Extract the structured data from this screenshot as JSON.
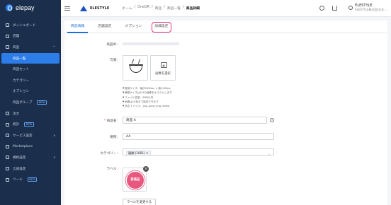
{
  "app": {
    "logo_text": "elepay"
  },
  "sidebar": {
    "items": [
      {
        "label": "ダッシュボード",
        "icon": "dashboard-icon"
      },
      {
        "label": "店舗",
        "icon": "store-icon"
      },
      {
        "label": "商品",
        "icon": "product-icon",
        "caret": "^"
      },
      {
        "label": "商品一覧",
        "sub": true,
        "active": true
      },
      {
        "label": "商品セット",
        "sub": true
      },
      {
        "label": "カテゴリー",
        "sub": true
      },
      {
        "label": "オプション",
        "sub": true
      },
      {
        "label": "商品グループ",
        "sub": true,
        "badge": "BETA"
      },
      {
        "label": "注文",
        "icon": "order-icon"
      },
      {
        "label": "統計",
        "icon": "stats-icon",
        "badge": "BETA"
      },
      {
        "label": "サービス設定",
        "icon": "service-icon",
        "caret": "v"
      },
      {
        "label": "Marketplace",
        "icon": "marketplace-icon"
      },
      {
        "label": "規約設定",
        "icon": "terms-icon",
        "caret": "v"
      },
      {
        "label": "言語設定",
        "icon": "language-icon"
      },
      {
        "label": "ツール",
        "icon": "tool-icon",
        "badge": "BETA"
      }
    ]
  },
  "topbar": {
    "brand": "ELESTYLE",
    "breadcrumbs": [
      "ホーム",
      "/",
      "OneQR",
      "/",
      "商品",
      "/",
      "商品一覧",
      "/"
    ],
    "current": "商品詳細",
    "user_name": "ELESTYLE",
    "user_company": "ELESTYLE株式会社(本..."
  },
  "tabs": [
    {
      "label": "商品情報",
      "active": true
    },
    {
      "label": "店舗設定"
    },
    {
      "label": "オプション"
    },
    {
      "label": "詳細設定",
      "highlight": true
    }
  ],
  "form": {
    "id_label": "商品ID:",
    "photo_label": "写真:",
    "photo_select_text": "画像を選択",
    "hints": [
      "推奨サイズ：幅が1600px × 高1200px",
      "横縦サイズは4:3の画像をオススメします",
      "ファイル容量：5MB以内",
      "画像は10枚まで追加できます",
      "対応ファイル：.jpg,.jpeg,.png,.webp"
    ],
    "name_label": "商品名:",
    "name_value": "商品 A",
    "abbr_label": "略称:",
    "abbr_value": "AA",
    "category_label": "カテゴリー:",
    "category_chip": "麺類 (1001)",
    "label_label": "ラベル:",
    "label_stamp": "新商品",
    "change_label_button": "ラベルを変更する"
  }
}
